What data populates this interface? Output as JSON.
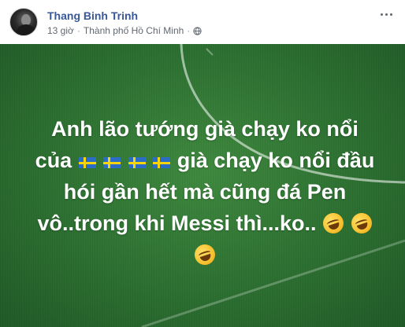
{
  "post": {
    "author": "Thang Binh Trinh",
    "time": "13 giờ",
    "separator": "·",
    "location": "Thành phố Hồ Chí Minh",
    "privacy_icon": "globe-icon",
    "more_icon": "more-options-icon"
  },
  "image": {
    "background": "soccer-field-grass",
    "caption_lines": [
      "Anh lão tướng già chạy ko nổi",
      {
        "before": "của ",
        "flags": 4,
        "after": " già chạy ko nổi đầu"
      },
      "hói gần hết mà cũng đá Pen",
      {
        "text": "vô..trong khi Messi thì...ko..",
        "emojis": 2
      },
      {
        "emojis": 1
      }
    ],
    "flag_icon": "sweden-flag-icon",
    "emoji_icon": "rolling-on-floor-laughing-icon"
  },
  "colors": {
    "author": "#385898",
    "meta": "#616770",
    "grass": "#2f7433",
    "caption": "#ffffff"
  }
}
